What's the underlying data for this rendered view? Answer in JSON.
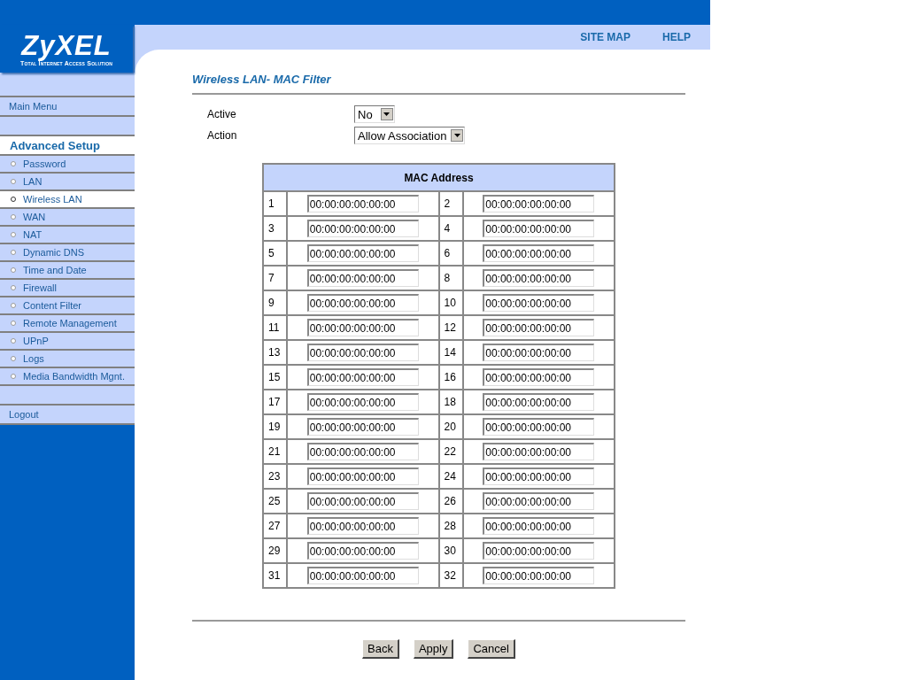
{
  "logo": {
    "name": "ZyXEL",
    "tagline": "Total Internet Access Solution"
  },
  "top_links": [
    "SITE MAP",
    "HELP"
  ],
  "sidebar": {
    "main_menu": "Main Menu",
    "section": "Advanced Setup",
    "items": [
      {
        "label": "Password",
        "selected": false
      },
      {
        "label": "LAN",
        "selected": false
      },
      {
        "label": "Wireless LAN",
        "selected": true
      },
      {
        "label": "WAN",
        "selected": false
      },
      {
        "label": "NAT",
        "selected": false
      },
      {
        "label": "Dynamic DNS",
        "selected": false
      },
      {
        "label": "Time and Date",
        "selected": false
      },
      {
        "label": "Firewall",
        "selected": false
      },
      {
        "label": "Content Filter",
        "selected": false
      },
      {
        "label": "Remote Management",
        "selected": false
      },
      {
        "label": "UPnP",
        "selected": false
      },
      {
        "label": "Logs",
        "selected": false
      },
      {
        "label": "Media Bandwidth Mgnt.",
        "selected": false
      }
    ],
    "logout": "Logout"
  },
  "page_title": "Wireless LAN- MAC Filter",
  "settings": [
    {
      "label": "Active",
      "value": "No"
    },
    {
      "label": "Action",
      "value": "Allow Association"
    }
  ],
  "table": {
    "header": "MAC Address",
    "entries": [
      {
        "number": "1",
        "value": "00:00:00:00:00:00"
      },
      {
        "number": "2",
        "value": "00:00:00:00:00:00"
      },
      {
        "number": "3",
        "value": "00:00:00:00:00:00"
      },
      {
        "number": "4",
        "value": "00:00:00:00:00:00"
      },
      {
        "number": "5",
        "value": "00:00:00:00:00:00"
      },
      {
        "number": "6",
        "value": "00:00:00:00:00:00"
      },
      {
        "number": "7",
        "value": "00:00:00:00:00:00"
      },
      {
        "number": "8",
        "value": "00:00:00:00:00:00"
      },
      {
        "number": "9",
        "value": "00:00:00:00:00:00"
      },
      {
        "number": "10",
        "value": "00:00:00:00:00:00"
      },
      {
        "number": "11",
        "value": "00:00:00:00:00:00"
      },
      {
        "number": "12",
        "value": "00:00:00:00:00:00"
      },
      {
        "number": "13",
        "value": "00:00:00:00:00:00"
      },
      {
        "number": "14",
        "value": "00:00:00:00:00:00"
      },
      {
        "number": "15",
        "value": "00:00:00:00:00:00"
      },
      {
        "number": "16",
        "value": "00:00:00:00:00:00"
      },
      {
        "number": "17",
        "value": "00:00:00:00:00:00"
      },
      {
        "number": "18",
        "value": "00:00:00:00:00:00"
      },
      {
        "number": "19",
        "value": "00:00:00:00:00:00"
      },
      {
        "number": "20",
        "value": "00:00:00:00:00:00"
      },
      {
        "number": "21",
        "value": "00:00:00:00:00:00"
      },
      {
        "number": "22",
        "value": "00:00:00:00:00:00"
      },
      {
        "number": "23",
        "value": "00:00:00:00:00:00"
      },
      {
        "number": "24",
        "value": "00:00:00:00:00:00"
      },
      {
        "number": "25",
        "value": "00:00:00:00:00:00"
      },
      {
        "number": "26",
        "value": "00:00:00:00:00:00"
      },
      {
        "number": "27",
        "value": "00:00:00:00:00:00"
      },
      {
        "number": "28",
        "value": "00:00:00:00:00:00"
      },
      {
        "number": "29",
        "value": "00:00:00:00:00:00"
      },
      {
        "number": "30",
        "value": "00:00:00:00:00:00"
      },
      {
        "number": "31",
        "value": "00:00:00:00:00:00"
      },
      {
        "number": "32",
        "value": "00:00:00:00:00:00"
      }
    ]
  },
  "buttons": [
    "Back",
    "Apply",
    "Cancel"
  ]
}
